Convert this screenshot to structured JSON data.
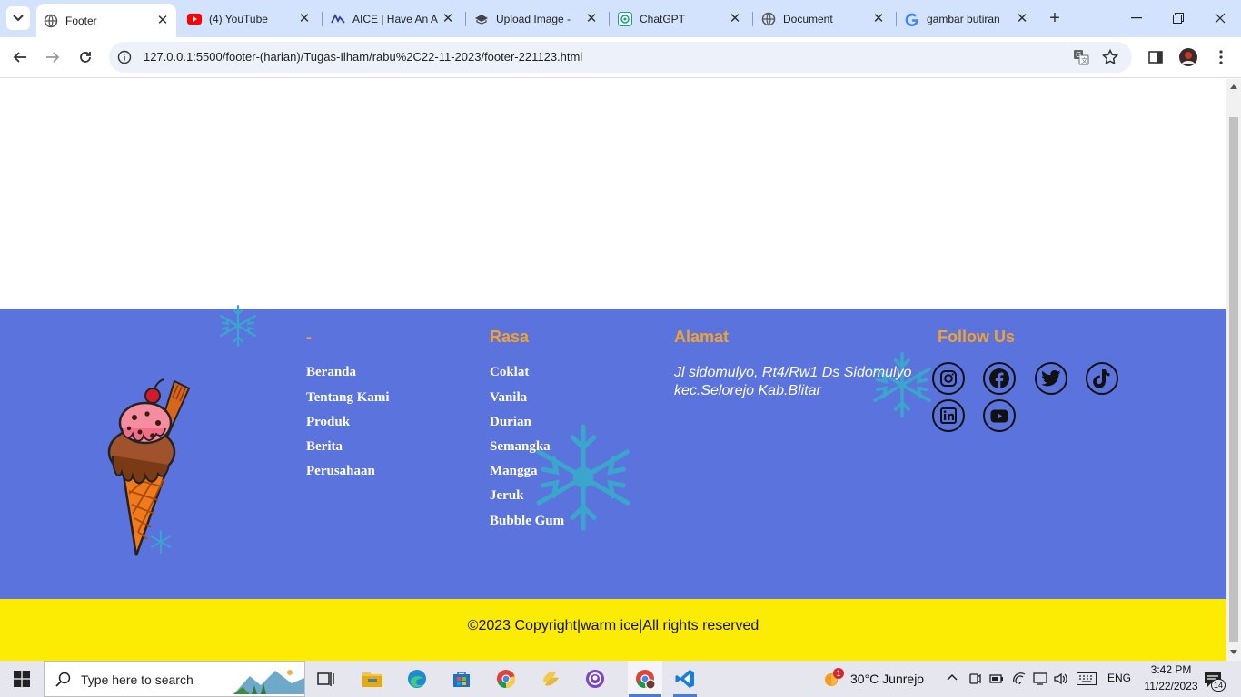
{
  "browser": {
    "tabs": [
      {
        "title": "Footer",
        "active": true,
        "favicon": "globe-icon"
      },
      {
        "title": "(4) YouTube",
        "active": false,
        "favicon": "youtube-icon"
      },
      {
        "title": "AICE | Have An A",
        "active": false,
        "favicon": "aice-icon"
      },
      {
        "title": "Upload Image -",
        "active": false,
        "favicon": "upload-icon"
      },
      {
        "title": "ChatGPT",
        "active": false,
        "favicon": "chatgpt-icon"
      },
      {
        "title": "Document",
        "active": false,
        "favicon": "globe-icon"
      },
      {
        "title": "gambar butiran",
        "active": false,
        "favicon": "google-icon"
      }
    ],
    "url": "127.0.0.1:5500/footer-(harian)/Tugas-Ilham/rabu%2C22-11-2023/footer-221123.html"
  },
  "footer": {
    "col1": {
      "title": "-",
      "links": [
        "Beranda",
        "Tentang Kami",
        "Produk",
        "Berita",
        "Perusahaan"
      ]
    },
    "col2": {
      "title": "Rasa",
      "links": [
        "Coklat",
        "Vanila",
        "Durian",
        "Semangka",
        "Mangga",
        "Jeruk",
        "Bubble Gum"
      ]
    },
    "col3": {
      "title": "Alamat",
      "address_line1": "Jl sidomulyo, Rt4/Rw1 Ds Sidomulyo",
      "address_line2": "kec.Selorejo Kab.Blitar"
    },
    "col4": {
      "title": "Follow Us",
      "socials": [
        "instagram-icon",
        "facebook-icon",
        "twitter-icon",
        "tiktok-icon",
        "linkedin-icon",
        "youtube-icon"
      ]
    },
    "copyright": "©2023 Copyright|warm ice|All rights reserved",
    "colors": {
      "footer_bg": "#5b73dd",
      "title": "#f2a22c",
      "copyright_bg": "#fcec04"
    }
  },
  "taskbar": {
    "search_placeholder": "Type here to search",
    "weather": "30°C  Junrejo",
    "weather_badge": "1",
    "language": "ENG",
    "time": "3:42 PM",
    "date": "11/22/2023",
    "notifications": "14"
  }
}
